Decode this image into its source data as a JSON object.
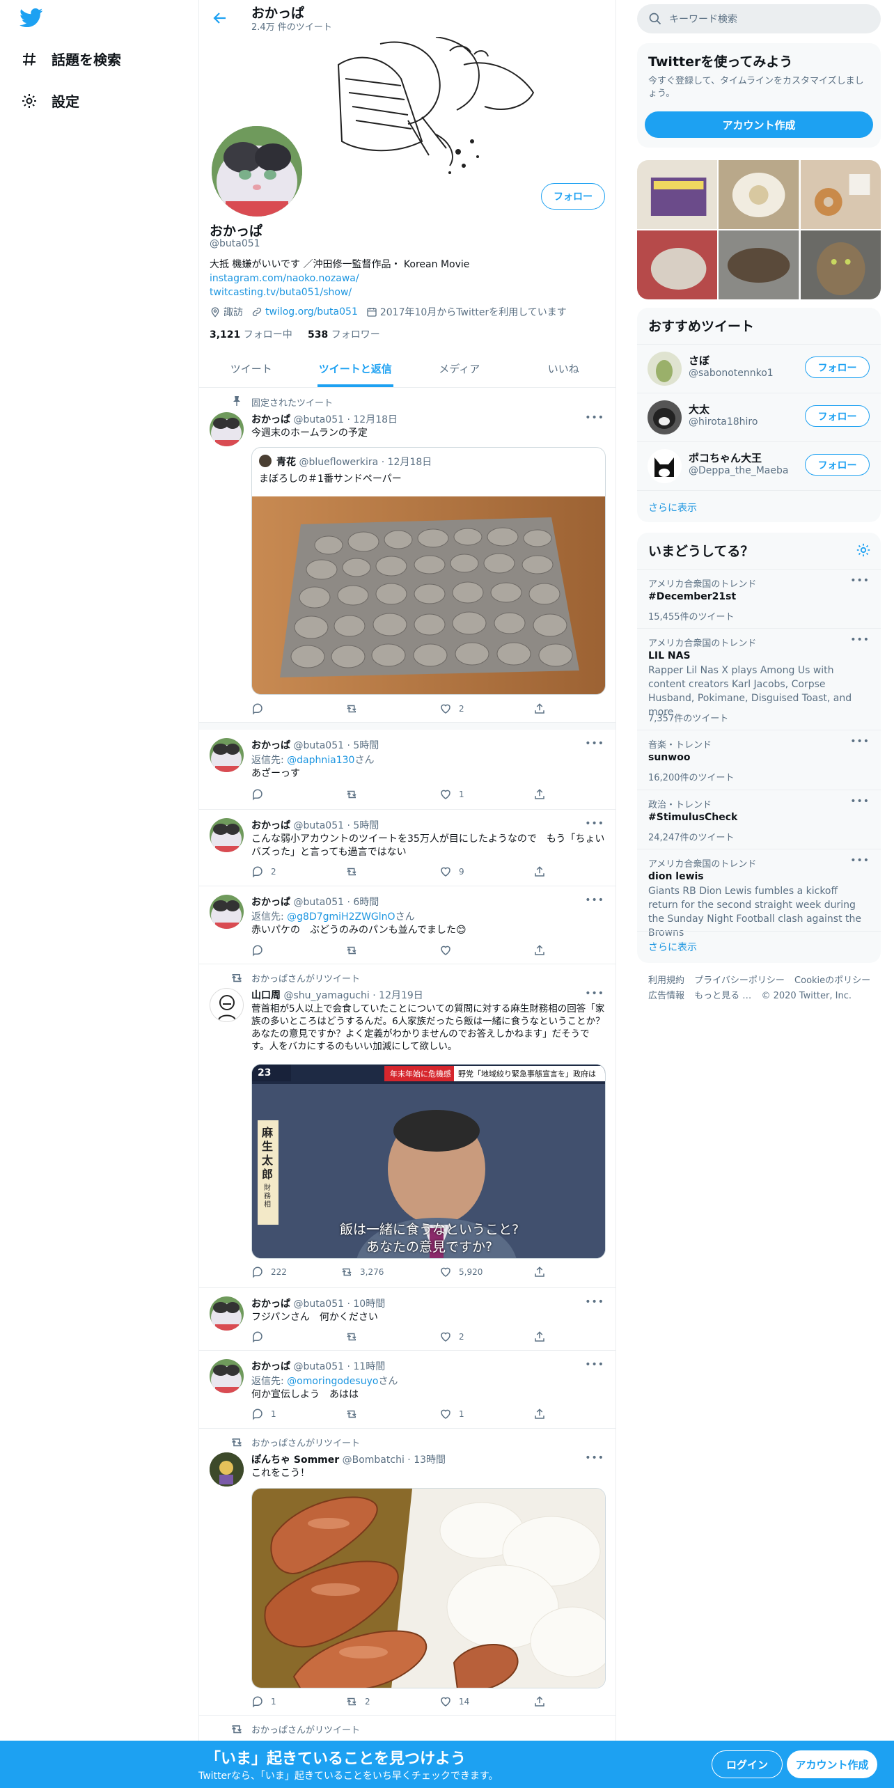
{
  "nav": {
    "explore_label": "話題を検索",
    "settings_label": "設定"
  },
  "header": {
    "name": "おかっぱ",
    "tweet_count": "2.4万 件のツイート"
  },
  "profile": {
    "name": "おかっぱ",
    "handle": "@buta051",
    "follow_label": "フォロー",
    "bio_line1": "大抵 機嫌がいいです ／沖田修一監督作品・ Korean Movie",
    "bio_link1": "instagram.com/naoko.nozawa/",
    "bio_link2": "twitcasting.tv/buta051/show/",
    "location": "諏訪",
    "website": "twilog.org/buta051",
    "joined": "2017年10月からTwitterを利用しています",
    "following_count": "3,121",
    "following_label": "フォロー中",
    "followers_count": "538",
    "followers_label": "フォロワー"
  },
  "tabs": [
    "ツイート",
    "ツイートと返信",
    "メディア",
    "いいね"
  ],
  "tweets": [
    {
      "social": "固定されたツイート",
      "name": "おかっぱ",
      "handle": "@buta051",
      "time": "12月18日",
      "text": "今週末のホームランの予定",
      "quote_name": "青花",
      "quote_handle": "@blueflowerkira",
      "quote_time": "12月18日",
      "quote_text": "まぼろしの＃1番サンドペーパー",
      "replies": "",
      "retweets": "",
      "likes": "2"
    },
    {
      "name": "おかっぱ",
      "handle": "@buta051",
      "time": "5時間",
      "reply_prefix": "返信先:",
      "reply_to": "@daphnia130",
      "reply_suffix": "さん",
      "text": "あざーっす",
      "replies": "",
      "retweets": "",
      "likes": "1"
    },
    {
      "name": "おかっぱ",
      "handle": "@buta051",
      "time": "5時間",
      "text": "こんな弱小アカウントのツイートを35万人が目にしたようなので　もう「ちょいバズった」と言っても過言ではない",
      "replies": "2",
      "retweets": "",
      "likes": "9"
    },
    {
      "name": "おかっぱ",
      "handle": "@buta051",
      "time": "6時間",
      "reply_prefix": "返信先:",
      "reply_to": "@g8D7gmiH2ZWGlnO",
      "reply_suffix": "さん",
      "text": "赤いパケの　ぶどうのみのパンも並んでました😊",
      "replies": "",
      "retweets": "",
      "likes": ""
    },
    {
      "social": "おかっぱさんがリツイート",
      "name": "山口周",
      "handle": "@shu_yamaguchi",
      "time": "12月19日",
      "text": "菅首相が5人以上で会食していたことについての質問に対する麻生財務相の回答「家族の多いところはどうするんだ。6人家族だったら飯は一緒に食うなということか？あなたの意見ですか？よく定義がわかりませんのでお答えしかねます」だそうです。人をバカにするのもいい加減にして欲しい。",
      "caption_top": "年末年始に危機感",
      "caption_top2": "野党「地域絞り緊急事態宣言を」政府は",
      "caption_side": "麻生太郎",
      "caption_side2": "財務相",
      "caption1": "飯は一緒に食うなということ?",
      "caption2": "あなたの意見ですか?",
      "channel": "23",
      "replies": "222",
      "retweets": "3,276",
      "likes": "5,920"
    },
    {
      "name": "おかっぱ",
      "handle": "@buta051",
      "time": "10時間",
      "text": "フジパンさん　何かください",
      "replies": "",
      "retweets": "",
      "likes": "2"
    },
    {
      "name": "おかっぱ",
      "handle": "@buta051",
      "time": "11時間",
      "reply_prefix": "返信先:",
      "reply_to": "@omoringodesuyo",
      "reply_suffix": "さん",
      "text": "何か宣伝しよう　あはは",
      "replies": "1",
      "retweets": "",
      "likes": "1"
    },
    {
      "social": "おかっぱさんがリツイート",
      "name": "ぽんちゃ Sommer",
      "handle": "@Bombatchi",
      "time": "13時間",
      "text": "これをこう！",
      "replies": "1",
      "retweets": "2",
      "likes": "14"
    },
    {
      "social": "おかっぱさんがリツイート"
    }
  ],
  "right": {
    "search_placeholder": "キーワード検索",
    "signup_card": {
      "title": "Twitterを使ってみよう",
      "desc": "今すぐ登録して、タイムラインをカスタマイズしましょう。",
      "button": "アカウント作成"
    },
    "recommend": {
      "title": "おすすめツイート",
      "users": [
        {
          "name": "さぼ",
          "handle": "@sabonotennko1",
          "button": "フォロー"
        },
        {
          "name": "大太",
          "handle": "@hirota18hiro",
          "button": "フォロー"
        },
        {
          "name": "ポコちゃん大王",
          "handle": "@Deppa_the_Maeba",
          "button": "フォロー"
        }
      ],
      "more": "さらに表示"
    },
    "trends": {
      "title": "いまどうしてる？",
      "items": [
        {
          "context": "アメリカ合衆国のトレンド",
          "name": "#December21st",
          "desc": "",
          "count": "15,455件のツイート"
        },
        {
          "context": "アメリカ合衆国のトレンド",
          "name": "LIL NAS",
          "desc": "Rapper Lil Nas X plays Among Us with content creators Karl Jacobs, Corpse Husband, Pokimane, Disguised Toast, and more",
          "count": "7,357件のツイート"
        },
        {
          "context": "音楽・トレンド",
          "name": "sunwoo",
          "desc": "",
          "count": "16,200件のツイート"
        },
        {
          "context": "政治・トレンド",
          "name": "#StimulusCheck",
          "desc": "",
          "count": "24,247件のツイート"
        },
        {
          "context": "アメリカ合衆国のトレンド",
          "name": "dion lewis",
          "desc": "Giants RB Dion Lewis fumbles a kickoff return for the second straight week during the Sunday Night Football clash against the Browns",
          "count": ""
        }
      ],
      "more": "さらに表示"
    },
    "footer": [
      "利用規約",
      "プライバシーポリシー",
      "Cookieのポリシー",
      "広告情報",
      "もっと見る …",
      "© 2020 Twitter, Inc."
    ]
  },
  "bottom_bar": {
    "title": "「いま」起きていることを見つけよう",
    "subtitle": "Twitterなら、「いま」起きていることをいち早くチェックできます。",
    "login": "ログイン",
    "signup": "アカウント作成"
  },
  "colors": {
    "accent": "#1da1f2",
    "link": "#1b95e0",
    "muted": "#5b7083"
  }
}
